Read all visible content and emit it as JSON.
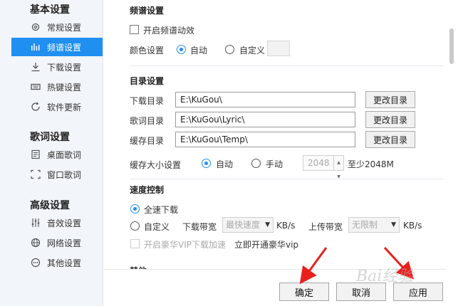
{
  "sidebar": {
    "groups": [
      {
        "title": "基本设置"
      },
      {
        "title": "歌词设置"
      },
      {
        "title": "高级设置"
      }
    ],
    "items": [
      {
        "label": "常规设置",
        "icon": "gear-icon"
      },
      {
        "label": "频谱设置",
        "icon": "spectrum-icon",
        "active": true
      },
      {
        "label": "下载设置",
        "icon": "download-icon"
      },
      {
        "label": "热键设置",
        "icon": "keyboard-icon"
      },
      {
        "label": "软件更新",
        "icon": "update-icon"
      },
      {
        "label": "桌面歌词",
        "icon": "desktop-lyric-icon"
      },
      {
        "label": "窗口歌词",
        "icon": "window-lyric-icon"
      },
      {
        "label": "音效设置",
        "icon": "equalizer-icon"
      },
      {
        "label": "网络设置",
        "icon": "globe-icon"
      },
      {
        "label": "其他设置",
        "icon": "more-icon"
      }
    ]
  },
  "spectrum": {
    "title": "频谱设置",
    "enable_label": "开启频谱动效",
    "color_label": "颜色设置",
    "auto_label": "自动",
    "custom_label": "自定义"
  },
  "directory": {
    "title": "目录设置",
    "rows": [
      {
        "label": "下载目录",
        "value": "E:\\KuGou\\",
        "button": "更改目录"
      },
      {
        "label": "歌词目录",
        "value": "E:\\KuGou\\Lyric\\",
        "button": "更改目录"
      },
      {
        "label": "缓存目录",
        "value": "E:\\KuGou\\Temp\\",
        "button": "更改目录"
      }
    ],
    "cache_label": "缓存大小设置",
    "auto_label": "自动",
    "manual_label": "手动",
    "cache_value": "2048",
    "min_note": "至少2048M"
  },
  "speed": {
    "title": "速度控制",
    "full_label": "全速下载",
    "custom_label": "自定义",
    "down_label": "下载带宽",
    "down_value": "最快速度",
    "unit": "KB/s",
    "up_label": "上传带宽",
    "up_value": "无限制",
    "vip_label": "开启豪华VIP下载加速",
    "vip_link": "立即开通豪华vip"
  },
  "other": {
    "title": "其他"
  },
  "footer": {
    "ok": "确定",
    "cancel": "取消",
    "apply": "应用"
  },
  "watermark": "Bai经验",
  "colors": {
    "accent": "#1f8ff0",
    "arrow": "#e8201c"
  }
}
